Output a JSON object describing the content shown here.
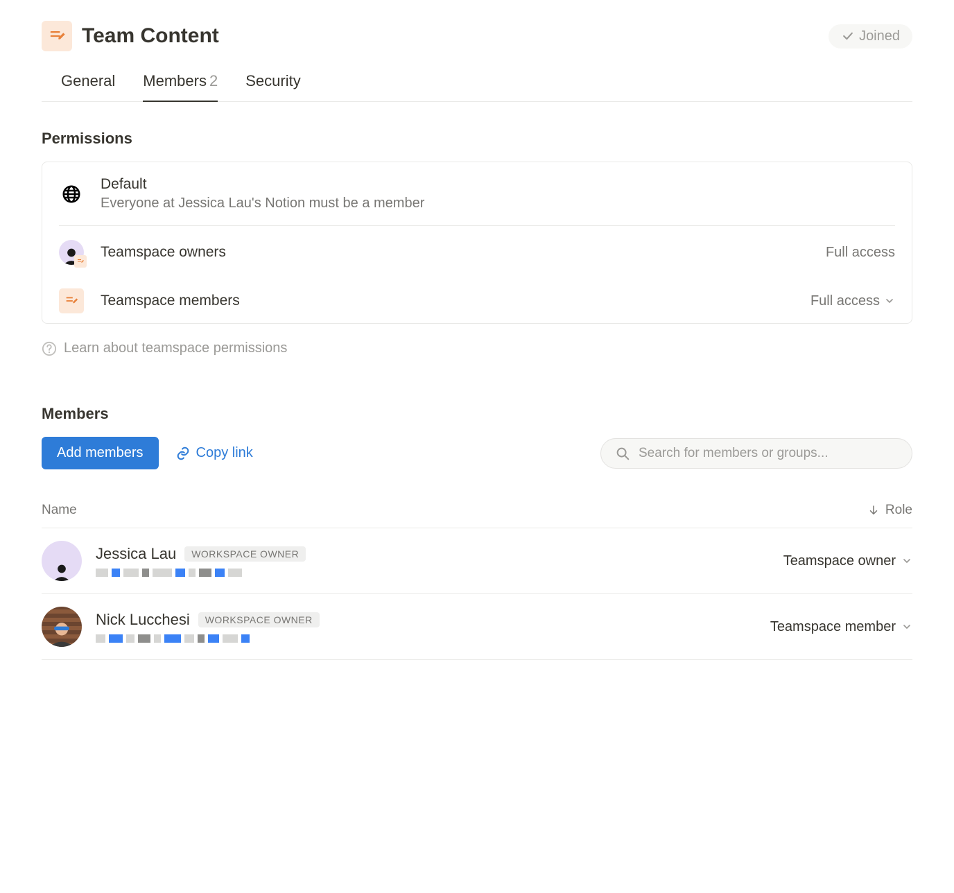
{
  "header": {
    "title": "Team Content",
    "joined_label": "Joined"
  },
  "tabs": {
    "general": "General",
    "members": "Members",
    "members_count": "2",
    "security": "Security"
  },
  "permissions": {
    "heading": "Permissions",
    "default_title": "Default",
    "default_desc": "Everyone at Jessica Lau's Notion must be a member",
    "owners_label": "Teamspace owners",
    "owners_access": "Full access",
    "members_label": "Teamspace members",
    "members_access": "Full access",
    "learn_link": "Learn about teamspace permissions"
  },
  "members": {
    "heading": "Members",
    "add_btn": "Add members",
    "copy_link": "Copy link",
    "search_placeholder": "Search for members or groups...",
    "col_name": "Name",
    "col_role": "Role",
    "rows": [
      {
        "name": "Jessica Lau",
        "badge": "WORKSPACE OWNER",
        "role": "Teamspace owner"
      },
      {
        "name": "Nick Lucchesi",
        "badge": "WORKSPACE OWNER",
        "role": "Teamspace member"
      }
    ]
  }
}
